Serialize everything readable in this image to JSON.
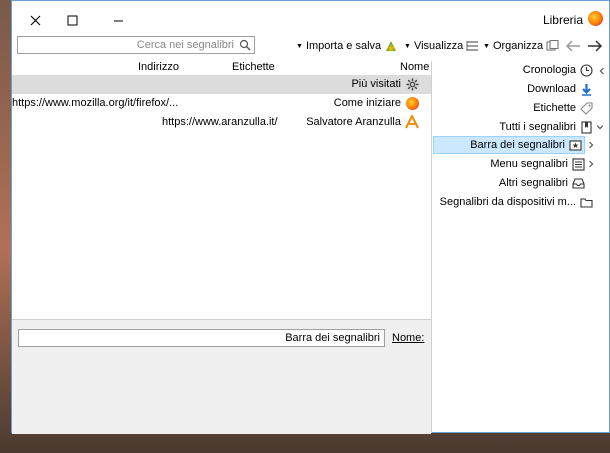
{
  "window": {
    "title": "Libreria",
    "minimize": "–",
    "maximize": "□",
    "close": "✕"
  },
  "toolbar": {
    "search_placeholder": "Cerca nei segnalibri",
    "import_label": "Importa e salva",
    "view_label": "Visualizza",
    "organize_label": "Organizza"
  },
  "columns": {
    "name": "Nome",
    "tags": "Etichette",
    "address": "Indirizzo"
  },
  "rows": [
    {
      "name": "Più visitati",
      "address": "",
      "tags": "",
      "icon": "gear-icon"
    },
    {
      "name": "Come iniziare",
      "address": "https://www.mozilla.org/it/firefox/...",
      "tags": "",
      "icon": "firefox-icon"
    },
    {
      "name": "Salvatore Aranzulla",
      "address": "https://www.aranzulla.it/",
      "tags": "",
      "icon": "aranzulla-icon"
    }
  ],
  "detail": {
    "name_label": "Nome:",
    "name_value": "Barra dei segnalibri"
  },
  "tree": [
    {
      "label": "Cronologia",
      "icon": "clock-icon"
    },
    {
      "label": "Download",
      "icon": "download-icon"
    },
    {
      "label": "Etichette",
      "icon": "tag-icon"
    },
    {
      "label": "Tutti i segnalibri",
      "icon": "bookmarks-icon"
    },
    {
      "label": "Barra dei segnalibri",
      "icon": "bookmarks-toolbar-icon"
    },
    {
      "label": "Menu segnalibri",
      "icon": "menu-icon"
    },
    {
      "label": "Altri segnalibri",
      "icon": "folder-icon"
    },
    {
      "label": "Segnalibri da dispositivi m...",
      "icon": "folder-icon"
    }
  ],
  "colors": {
    "selection": "#cce8ff",
    "row_selected": "#dcdcdc",
    "window_border": "#6aa0d0",
    "download_blue": "#1e6fd0"
  }
}
